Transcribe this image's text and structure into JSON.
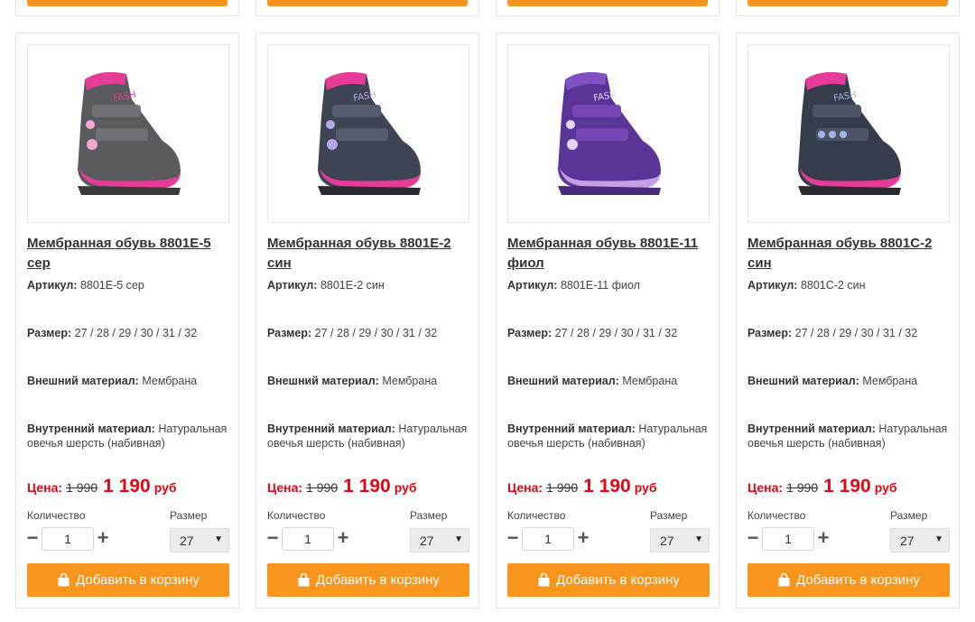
{
  "labels": {
    "article": "Артикул:",
    "size": "Размер:",
    "outer_material": "Внешний материал:",
    "inner_material": "Внутренний материал:",
    "price": "Цена:",
    "currency": "руб",
    "quantity": "Количество",
    "size_short": "Размер",
    "add_to_cart": "Добавить в корзину",
    "minus": "−",
    "plus": "+"
  },
  "colors": {
    "accent_orange": "#f8951d",
    "price_red": "#e30613"
  },
  "products": [
    {
      "title": "Мембранная обувь 8801E-5 сер",
      "article": "8801E-5 сер",
      "sizes": "27 / 28 / 29 / 30 / 31 / 32",
      "outer_material": "Мембрана",
      "inner_material": "Натуральная овечья шерсть (набивная)",
      "price_old": "1 990",
      "price_new": "1 190",
      "quantity": "1",
      "selected_size": "27",
      "boot_color": "grey-pink"
    },
    {
      "title": "Мембранная обувь 8801E-2 син",
      "article": "8801E-2 син",
      "sizes": "27 / 28 / 29 / 30 / 31 / 32",
      "outer_material": "Мембрана",
      "inner_material": "Натуральная овечья шерсть (набивная)",
      "price_old": "1 990",
      "price_new": "1 190",
      "quantity": "1",
      "selected_size": "27",
      "boot_color": "navy-pink"
    },
    {
      "title": "Мембранная обувь 8801E-11 фиол",
      "article": "8801E-11 фиол",
      "sizes": "27 / 28 / 29 / 30 / 31 / 32",
      "outer_material": "Мембрана",
      "inner_material": "Натуральная овечья шерсть (набивная)",
      "price_old": "1 990",
      "price_new": "1 190",
      "quantity": "1",
      "selected_size": "27",
      "boot_color": "purple"
    },
    {
      "title": "Мембранная обувь 8801C-2 син",
      "article": "8801C-2 син",
      "sizes": "27 / 28 / 29 / 30 / 31 / 32",
      "outer_material": "Мембрана",
      "inner_material": "Натуральная овечья шерсть (набивная)",
      "price_old": "1 990",
      "price_new": "1 190",
      "quantity": "1",
      "selected_size": "27",
      "boot_color": "navy-pink"
    }
  ]
}
